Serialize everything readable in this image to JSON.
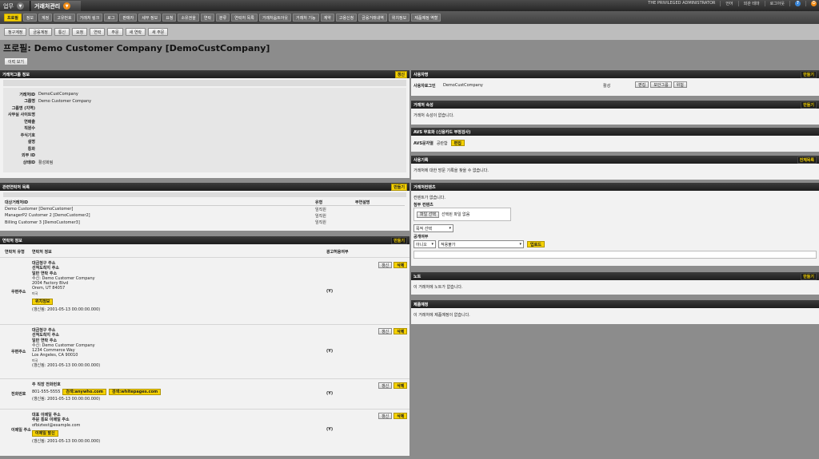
{
  "top": {
    "tab1": "업무",
    "tab2": "거래처관리",
    "admin": "THE PRIVILEGED ADMINISTRATOR",
    "links": [
      "언어",
      "외관 테마",
      "로그아웃"
    ]
  },
  "nav": [
    "프로필",
    "정보",
    "계정",
    "고유번호",
    "거래처 링크",
    "로그",
    "판매자",
    "세무 정보",
    "요청",
    "소유권을",
    "연락",
    "분류",
    "연락처 목록",
    "거래처옵트아웃",
    "거래처 기능",
    "계약",
    "고용신청",
    "금융거래내역",
    "위치정보",
    "제품예정 역할"
  ],
  "subnav": [
    "청구계정",
    "금융계정",
    "통신",
    "요청",
    "연락",
    "주문",
    "새 연락",
    "새 주문"
  ],
  "page_title": "프로필: Demo Customer Company [DemoCustCompany]",
  "audit_label": "이력 보기",
  "group": {
    "title": "거래처그룹 정보",
    "refresh": "갱신",
    "fields": [
      {
        "k": "거래처ID",
        "v": "DemoCustCompany"
      },
      {
        "k": "그룹명",
        "v": "Demo Customer Company"
      },
      {
        "k": "그룹명 (지역)",
        "v": ""
      },
      {
        "k": "사무실 사이트명",
        "v": ""
      },
      {
        "k": "연매출",
        "v": ""
      },
      {
        "k": "직원수",
        "v": ""
      },
      {
        "k": "주식기호",
        "v": ""
      },
      {
        "k": "설명",
        "v": ""
      },
      {
        "k": "통화",
        "v": ""
      },
      {
        "k": "외부 ID",
        "v": ""
      },
      {
        "k": "상태ID",
        "v": "활성화됨"
      }
    ]
  },
  "related": {
    "title": "관련연락처 목록",
    "create": "만들기",
    "headers": [
      "대상거래처ID",
      "유형",
      "부연설명"
    ],
    "rows": [
      {
        "name": "Demo Customer [DemoCustomer]",
        "type": "임직원"
      },
      {
        "name": "ManagerP2 Customer 2 [DemoCustomer2]",
        "type": "임직원"
      },
      {
        "name": "Billing Customer 3 [DemoCustomer3]",
        "type": "임직원"
      }
    ]
  },
  "contact": {
    "title": "연락처 정보",
    "create": "만들기",
    "headers": [
      "연락처 유형",
      "연락처 정보",
      "광고허용여부"
    ],
    "update": "갱신",
    "delete": "삭제",
    "rows": [
      {
        "type": "우편주소",
        "lines": [
          "대금청구 주소",
          "선적도착지 주소",
          "일반 연락 주소",
          "수신: Demo Customer Company",
          "2004 Factory Blvd",
          "Orem, UT 84057",
          "미국"
        ],
        "action": "위치정보",
        "updated": "(갱신됨: 2001-05-13 00:00:00.000)",
        "allow": "(Y)"
      },
      {
        "type": "우편주소",
        "lines": [
          "대금청구 주소",
          "선적도착지 주소",
          "일반 연락 주소",
          "수신: Demo Customer Company",
          "1234 Commerce Way",
          "Los Angeles, CA 90010",
          "미국"
        ],
        "updated": "(갱신됨: 2001-05-13 00:00:00.000)",
        "allow": "(Y)"
      },
      {
        "type": "전화번호",
        "lines": [
          "주 직장 전화번호"
        ],
        "phone": "801-555-5555",
        "search1": "검색:anywho.com",
        "search2": "검색:whitepages.com",
        "updated": "(갱신됨: 2001-05-13 00:00:00.000)",
        "allow": "(Y)"
      },
      {
        "type": "이메일 주소",
        "lines": [
          "대표 이메일 주소",
          "주문 통보 이메일 주소",
          "ofbiztest@example.com"
        ],
        "action": "이메일 발신",
        "updated": "(갱신됨: 2001-05-13 00:00:00.000)",
        "allow": "(Y)"
      }
    ]
  },
  "user": {
    "title": "사용자명",
    "create": "만들기",
    "label": "사용자로그인",
    "value": "DemoCustCompany",
    "status": "활성",
    "btns": [
      "편집",
      "보안그룹",
      "위험"
    ]
  },
  "attrs": {
    "title": "거래처 속성",
    "create": "만들기",
    "empty": "거래처 속성이 없습니다."
  },
  "avs": {
    "title": "AVS 무효화 (신용카드 부정검사)",
    "label": "AVS문자열",
    "value": "공란함",
    "edit": "편집"
  },
  "visits": {
    "title": "사용기록",
    "all": "전체목록",
    "empty": "거래처에 대한 방문 기록을 찾을 수 없습니다."
  },
  "content": {
    "title": "거래처컨텐츠",
    "empty": "컨텐트가 없습니다.",
    "attach_label": "첨부 컨텐츠",
    "file_btn": "파일 선택",
    "file_none": "선택된 파일 없음",
    "purpose": "목적 선택",
    "public_label": "공개여부",
    "public_value": "아니오",
    "role_value": "적용불가",
    "upload": "업로드"
  },
  "notes": {
    "title": "노트",
    "create": "만들기",
    "empty": "이 거래처에 노트가 없습니다."
  },
  "prod": {
    "title": "제품예정",
    "empty": "이 거래처에 제품예정이 없습니다."
  }
}
